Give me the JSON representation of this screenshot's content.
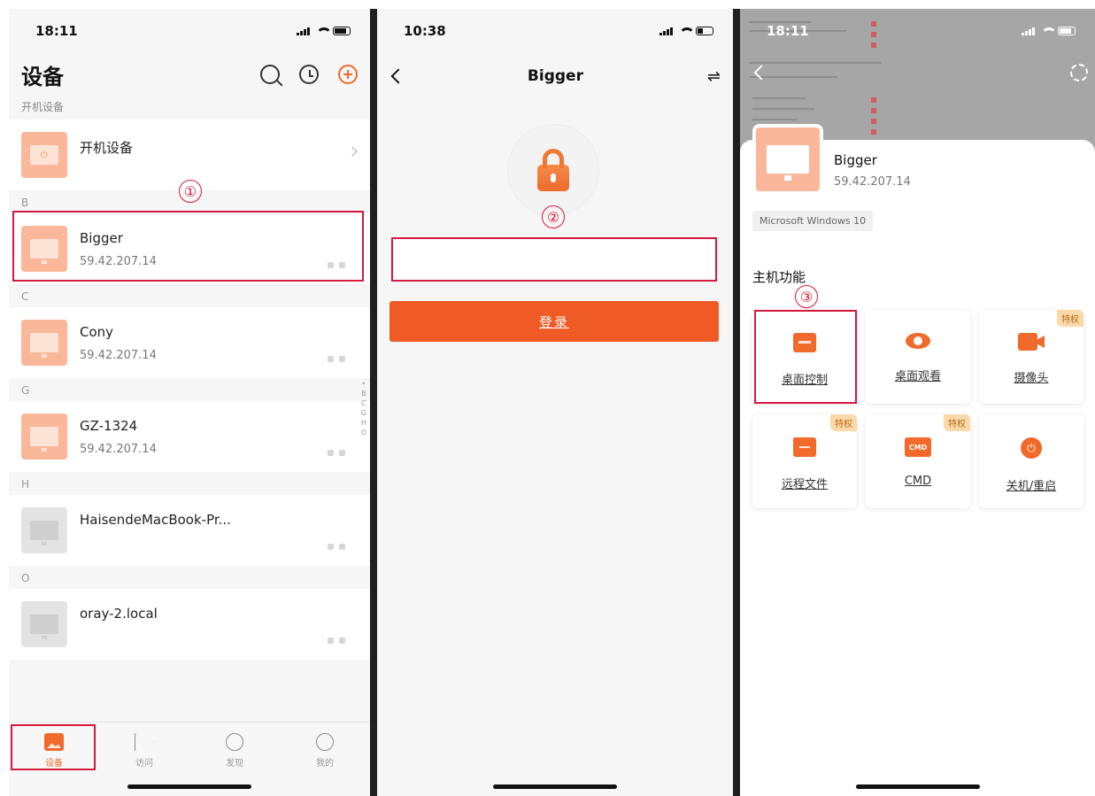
{
  "phone1": {
    "time": "18:11",
    "title": "设备",
    "sub_label": "开机设备",
    "power_row": {
      "name": "开机设备"
    },
    "sections": [
      {
        "letter": "B",
        "devices": [
          {
            "name": "Bigger",
            "ip": "59.42.207.14",
            "icon": "monitor-orange"
          }
        ]
      },
      {
        "letter": "C",
        "devices": [
          {
            "name": "Cony",
            "ip": "59.42.207.14",
            "icon": "monitor-orange"
          }
        ]
      },
      {
        "letter": "G",
        "devices": [
          {
            "name": "GZ-1324",
            "ip": "59.42.207.14",
            "icon": "monitor-orange"
          }
        ]
      },
      {
        "letter": "H",
        "devices": [
          {
            "name": "HaisendeMacBook-Pr...",
            "ip": "",
            "icon": "monitor-gray"
          }
        ]
      },
      {
        "letter": "O",
        "devices": [
          {
            "name": "oray-2.local",
            "ip": "",
            "icon": "monitor-gray"
          }
        ]
      }
    ],
    "index_letters": [
      "B",
      "C",
      "G",
      "H",
      "O"
    ],
    "tabs": [
      {
        "label": "设备",
        "icon": "devices-icon",
        "active": true
      },
      {
        "label": "访问",
        "icon": "visit-icon",
        "active": false
      },
      {
        "label": "发现",
        "icon": "compass-icon",
        "active": false
      },
      {
        "label": "我的",
        "icon": "profile-icon",
        "active": false
      }
    ],
    "step_badge": "①"
  },
  "phone2": {
    "time": "10:38",
    "title": "Bigger",
    "swap_glyph": "⇌",
    "password_value": "",
    "login_label": "登录",
    "step_badge": "②"
  },
  "phone3": {
    "time": "18:11",
    "device_name": "Bigger",
    "device_ip": "59.42.207.14",
    "os_tag": "Microsoft Windows 10",
    "section_title": "主机功能",
    "step_badge": "③",
    "functions": [
      {
        "label": "桌面控制",
        "icon": "remote-desktop-icon",
        "badge": ""
      },
      {
        "label": "桌面观看",
        "icon": "eye-icon",
        "badge": ""
      },
      {
        "label": "摄像头",
        "icon": "camera-icon",
        "badge": "特权"
      },
      {
        "label": "远程文件",
        "icon": "folder-icon",
        "badge": "特权"
      },
      {
        "label": "CMD",
        "icon": "cmd-icon",
        "badge": "特权",
        "icon_text": "CMD"
      },
      {
        "label": "关机/重启",
        "icon": "power-icon",
        "badge": ""
      }
    ]
  },
  "colors": {
    "accent": "#f05a24",
    "callout": "#d7183f",
    "badge_bg": "#fcd9a8"
  }
}
